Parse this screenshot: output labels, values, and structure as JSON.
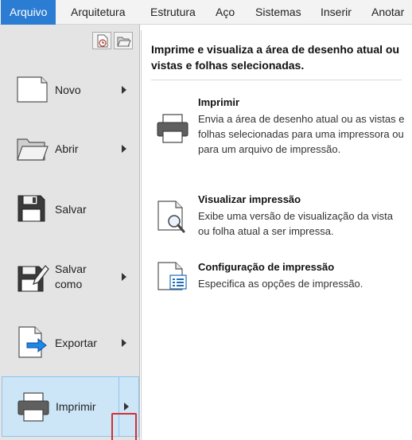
{
  "ribbon": {
    "tabs": [
      {
        "label": "Arquivo",
        "active": true
      },
      {
        "label": "Arquitetura"
      },
      {
        "label": "Estrutura"
      },
      {
        "label": "Aço"
      },
      {
        "label": "Sistemas"
      },
      {
        "label": "Inserir"
      },
      {
        "label": "Anotar"
      }
    ],
    "accent_color": "#2b7cd3"
  },
  "menu": {
    "quick_access_icons": [
      "recent-documents-icon",
      "open-documents-icon"
    ],
    "items": [
      {
        "label": "Novo",
        "icon": "new-document-icon",
        "has_submenu": true
      },
      {
        "label": "Abrir",
        "icon": "open-folder-icon",
        "has_submenu": true
      },
      {
        "label": "Salvar",
        "icon": "save-disk-icon",
        "has_submenu": false
      },
      {
        "label_line1": "Salvar",
        "label_line2": "como",
        "icon": "save-as-icon",
        "has_submenu": true
      },
      {
        "label": "Exportar",
        "icon": "export-icon",
        "has_submenu": true
      },
      {
        "label": "Imprimir",
        "icon": "printer-icon",
        "has_submenu": true,
        "selected": true
      }
    ],
    "selected_color": "#cde6f7",
    "highlight_color": "#d32f2f"
  },
  "flyout": {
    "heading": "Imprime e visualiza a área de desenho atual ou vistas e folhas selecionadas.",
    "options": [
      {
        "title": "Imprimir",
        "description": "Envia a área de desenho atual ou as vistas e folhas selecionadas para uma impressora ou para um arquivo de impressão.",
        "icon": "printer-icon"
      },
      {
        "title": "Visualizar impressão",
        "description": "Exibe uma versão de visualização da vista ou folha atual a ser impressa.",
        "icon": "print-preview-icon"
      },
      {
        "title": "Configuração de impressão",
        "description": "Especifica as opções de impressão.",
        "icon": "print-setup-icon"
      }
    ]
  }
}
